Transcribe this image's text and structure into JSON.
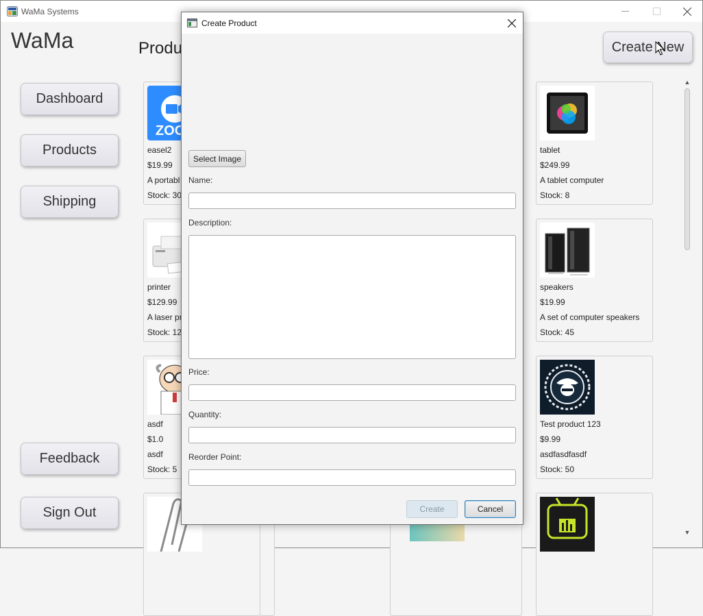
{
  "window": {
    "title": "WaMa Systems"
  },
  "brand": "WaMa",
  "nav": {
    "dashboard": "Dashboard",
    "products": "Products",
    "shipping": "Shipping",
    "feedback": "Feedback",
    "sign_out": "Sign Out"
  },
  "page_title": "Produ",
  "create_new": "Create New",
  "products": [
    {
      "name": "easel2",
      "price": "$19.99",
      "desc": "A portabl",
      "stock": "Stock: 30"
    },
    {
      "name": "printer",
      "price": "$129.99",
      "desc": "A laser pr",
      "stock": "Stock: 12"
    },
    {
      "name": "asdf",
      "price": "$1.0",
      "desc": "asdf",
      "stock": "Stock: 5"
    },
    {
      "name": "tablet",
      "price": "$249.99",
      "desc": "A tablet computer",
      "stock": "Stock: 8"
    },
    {
      "name": "speakers",
      "price": "$19.99",
      "desc": "A set of computer speakers",
      "stock": "Stock: 45"
    },
    {
      "name": "Test product 123",
      "price": "$9.99",
      "desc": "asdfasdfasdf",
      "stock": "Stock: 50"
    }
  ],
  "product_images": {
    "easel2": "zoom-logo",
    "printer": "printer-image",
    "asdf": "scientist-cartoon",
    "tablet": "tablet-image",
    "speakers": "speakers-image",
    "test_product": "hacker-emblem",
    "row4_left": "paperclip-image",
    "row4_right": "robot-tv-logo"
  },
  "dialog": {
    "title": "Create Product",
    "select_image": "Select Image",
    "name_label": "Name:",
    "name_value": "",
    "description_label": "Description:",
    "description_value": "",
    "price_label": "Price:",
    "price_value": "",
    "quantity_label": "Quantity:",
    "quantity_value": "",
    "reorder_label": "Reorder Point:",
    "reorder_value": "",
    "create": "Create",
    "cancel": "Cancel"
  },
  "colors": {
    "accent": "#3c7fb1",
    "zoom_blue": "#2d8cff",
    "disabled_button": "#dce7ef"
  }
}
